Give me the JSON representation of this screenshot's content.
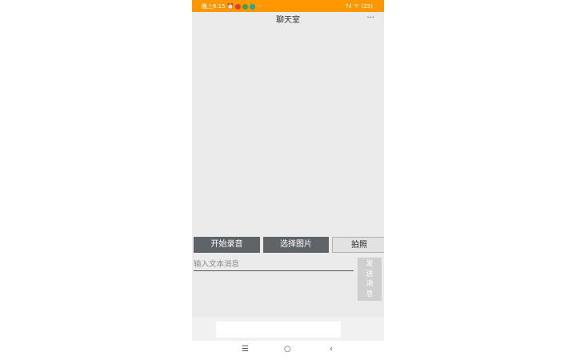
{
  "status_bar": {
    "time": "晚上6:15",
    "dots": "···",
    "signal": "?ıl",
    "wifi": "ᯤ",
    "battery": "(25)",
    "colors": {
      "background": "#ff9800",
      "red_badge": "#e53935",
      "green_badge": "#43a047",
      "teal_badge": "#26a69a"
    },
    "icons": [
      "alarm-icon",
      "notification-red-icon",
      "wechat-icon",
      "message-icon",
      "signal-icon",
      "wifi-icon",
      "battery-icon"
    ]
  },
  "header": {
    "title": "聊天室",
    "more": "···"
  },
  "actions": {
    "record": "开始录音",
    "choose_image": "选择图片",
    "photo": "拍照"
  },
  "input": {
    "value": "",
    "placeholder": "输入文本消息"
  },
  "send": {
    "label": "发送消息"
  },
  "navbar": {
    "menu": "☰",
    "home": "○",
    "back": "‹"
  }
}
